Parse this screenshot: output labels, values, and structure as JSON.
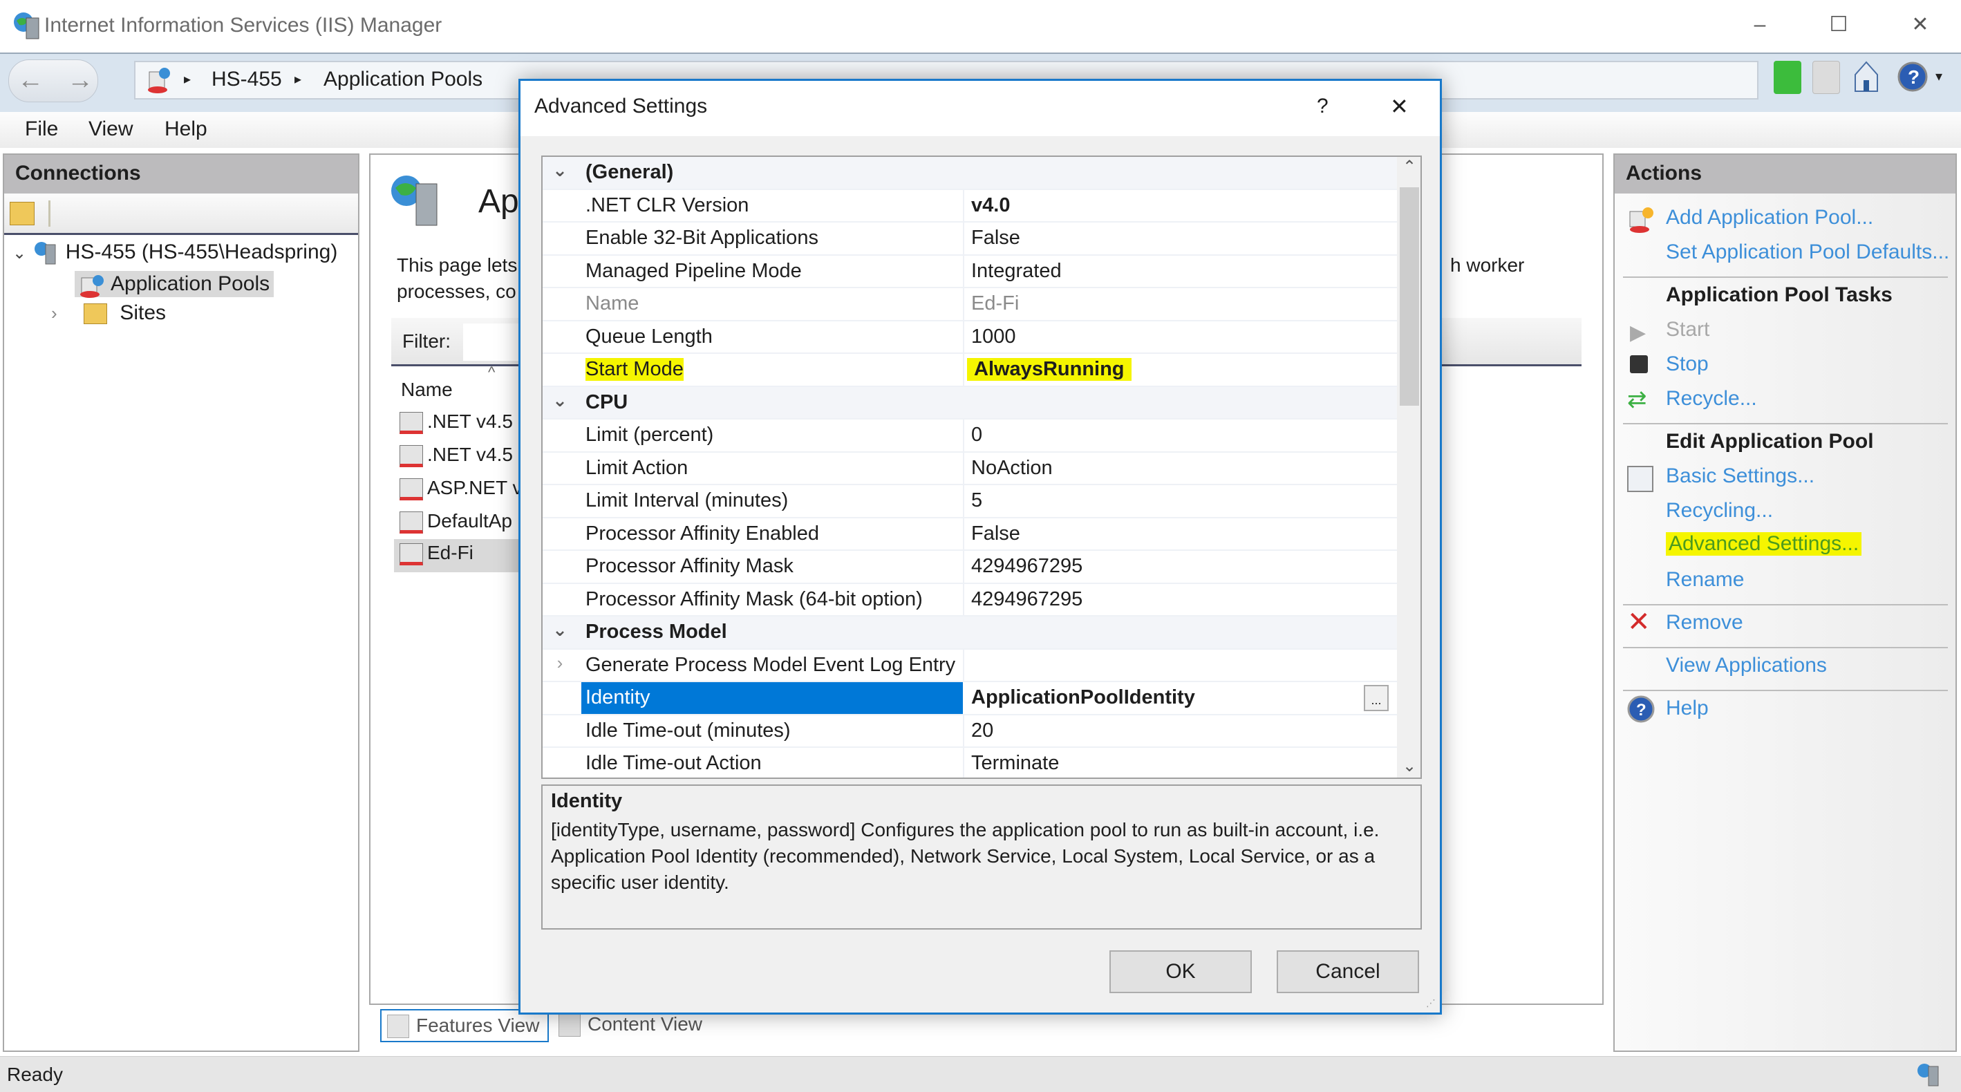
{
  "window": {
    "title": "Internet Information Services (IIS) Manager",
    "controls": {
      "minimize": "–",
      "maximize": "☐",
      "close": "✕"
    }
  },
  "address": {
    "crumbs": [
      "HS-455",
      "Application Pools"
    ],
    "separator": "▸",
    "toolbar_icons": [
      "refresh-icon",
      "stop-icon",
      "home-icon",
      "help-icon"
    ]
  },
  "menu": {
    "items": [
      "File",
      "View",
      "Help"
    ]
  },
  "connections": {
    "title": "Connections",
    "tree": {
      "server": "HS-455 (HS-455\\Headspring)",
      "children": [
        "Application Pools",
        "Sites"
      ],
      "selected": "Application Pools"
    }
  },
  "center": {
    "title_partial": "Ap",
    "desc_line1_partial": "This page lets",
    "desc_line2_partial": "processes, co",
    "desc_tail": "h worker",
    "filter_label": "Filter:",
    "column_name": "Name",
    "pools": [
      ".NET v4.5",
      ".NET v4.5",
      "ASP.NET v",
      "DefaultAp",
      "Ed-Fi"
    ],
    "selected_pool": "Ed-Fi",
    "view_tabs": [
      "Features View",
      "Content View"
    ],
    "active_view": "Features View"
  },
  "actions": {
    "title": "Actions",
    "add_pool": "Add Application Pool...",
    "set_defaults": "Set Application Pool Defaults...",
    "tasks_header": "Application Pool Tasks",
    "start": "Start",
    "stop": "Stop",
    "recycle": "Recycle...",
    "edit_header": "Edit Application Pool",
    "basic_settings": "Basic Settings...",
    "recycling": "Recycling...",
    "advanced_settings": "Advanced Settings...",
    "rename": "Rename",
    "remove": "Remove",
    "view_applications": "View Applications",
    "help": "Help",
    "highlight_color": "#f5f500",
    "link_color": "#3d8fd9"
  },
  "status": {
    "text": "Ready"
  },
  "dialog": {
    "title": "Advanced Settings",
    "help": "?",
    "close": "✕",
    "categories": [
      {
        "name": "(General)",
        "rows": [
          {
            "name": ".NET CLR Version",
            "value": "v4.0",
            "bold": true
          },
          {
            "name": "Enable 32-Bit Applications",
            "value": "False"
          },
          {
            "name": "Managed Pipeline Mode",
            "value": "Integrated"
          },
          {
            "name": "Name",
            "value": "Ed-Fi",
            "readonly": true
          },
          {
            "name": "Queue Length",
            "value": "1000"
          },
          {
            "name": "Start Mode",
            "value": "AlwaysRunning",
            "bold": true,
            "highlighted": true
          }
        ]
      },
      {
        "name": "CPU",
        "rows": [
          {
            "name": "Limit (percent)",
            "value": "0"
          },
          {
            "name": "Limit Action",
            "value": "NoAction"
          },
          {
            "name": "Limit Interval (minutes)",
            "value": "5"
          },
          {
            "name": "Processor Affinity Enabled",
            "value": "False"
          },
          {
            "name": "Processor Affinity Mask",
            "value": "4294967295"
          },
          {
            "name": "Processor Affinity Mask (64-bit option)",
            "value": "4294967295"
          }
        ]
      },
      {
        "name": "Process Model",
        "rows": [
          {
            "name": "Generate Process Model Event Log Entry",
            "value": "",
            "expandable": true
          },
          {
            "name": "Identity",
            "value": "ApplicationPoolIdentity",
            "bold": true,
            "selected": true,
            "has_ellipsis": true
          },
          {
            "name": "Idle Time-out (minutes)",
            "value": "20"
          },
          {
            "name": "Idle Time-out Action",
            "value": "Terminate"
          }
        ]
      }
    ],
    "ellipsis": "...",
    "description": {
      "title": "Identity",
      "text": "[identityType, username, password] Configures the application pool to run as built-in account, i.e. Application Pool Identity (recommended), Network Service, Local System, Local Service, or as a specific user identity."
    },
    "ok": "OK",
    "cancel": "Cancel",
    "selection_color": "#0078d7"
  }
}
